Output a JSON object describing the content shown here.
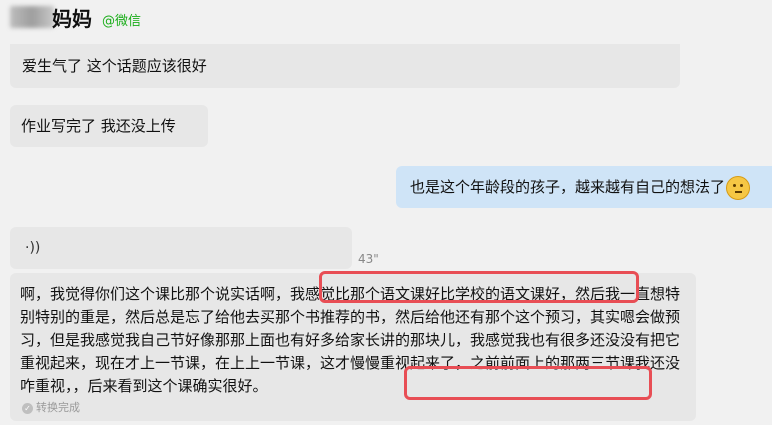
{
  "header": {
    "contact_name": "妈妈",
    "source": "@微信"
  },
  "messages": [
    {
      "text": "爱生气了 这个话题应该很好"
    },
    {
      "text": "作业写完了  我还没上传"
    },
    {
      "text": "也是这个年龄段的孩子，越来越有自己的想法了"
    }
  ],
  "voice": {
    "duration": "43\""
  },
  "voice_text": {
    "part1": "啊，我觉得你们这个课比那个说实话啊，",
    "highlight1": "我感觉比那个语文课好比学校的语文课好",
    "part2": "，然后我一直想特别特别的重是，然后总是忘了给他去买那个书推荐的书，然后给他还有那个这个预习，其实嗯会做预习，但是我感觉我自己节好像那那上面也有好多给家长讲的那块儿，我感觉我也有很多还没没有把它重视起来，现在才上一节课，在上上一节课，这才慢慢重视起来了，之前前面上的那两三节课我还没咋重视，",
    "highlight2": "，后来看到这个课确实很好。",
    "status": "转换完成"
  },
  "colors": {
    "highlight_border": "#e84e55",
    "outgoing_bubble": "#cfe4f7",
    "incoming_bubble": "#e7e7e7",
    "source_green": "#1aad19"
  },
  "icons": {
    "voice": "voice-wave-icon",
    "emoji": "thinking-face-icon",
    "status": "check-circle-icon"
  }
}
